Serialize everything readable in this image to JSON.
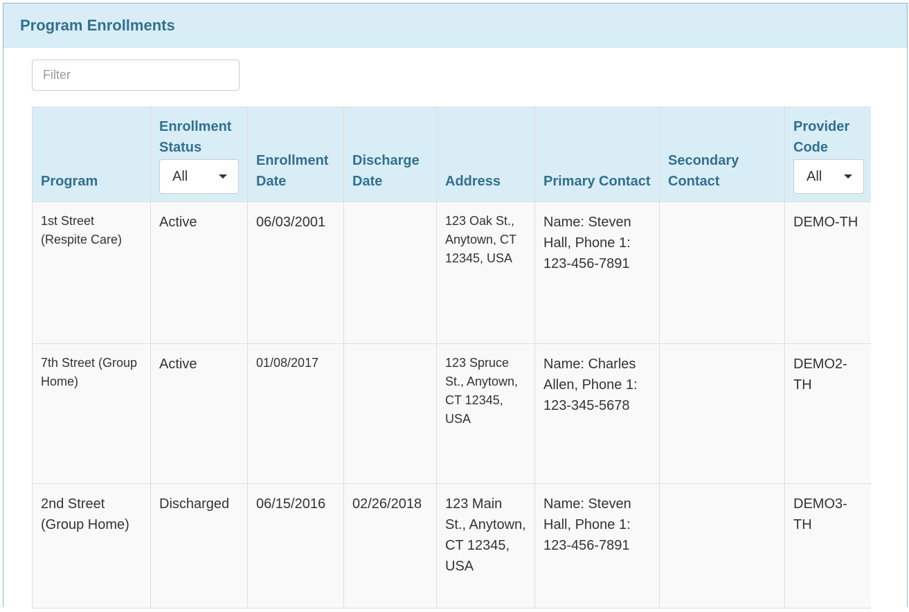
{
  "panel": {
    "title": "Program Enrollments"
  },
  "filter": {
    "placeholder": "Filter"
  },
  "table": {
    "headers": {
      "program": "Program",
      "enrollment_status": "Enrollment Status",
      "enrollment_date": "Enrollment Date",
      "discharge_date": "Discharge Date",
      "address": "Address",
      "primary_contact": "Primary Contact",
      "secondary_contact": "Secondary Contact",
      "provider_code": "Provider Code"
    },
    "status_filter": {
      "selected": "All"
    },
    "provider_filter": {
      "selected": "All"
    },
    "rows": [
      {
        "program": "1st Street (Respite Care)",
        "status": "Active",
        "enrollment_date": "06/03/2001",
        "discharge_date": "",
        "address": "123 Oak St., Anytown, CT 12345, USA",
        "primary_contact": "Name: Steven Hall, Phone 1: 123-456-7891",
        "secondary_contact": "",
        "provider_code": "DEMO-TH"
      },
      {
        "program": "7th Street (Group Home)",
        "status": "Active",
        "enrollment_date": "01/08/2017",
        "discharge_date": "",
        "address": "123 Spruce St., Anytown, CT 12345, USA",
        "primary_contact": "Name: Charles Allen, Phone 1: 123-345-5678",
        "secondary_contact": "",
        "provider_code": "DEMO2-TH"
      },
      {
        "program": "2nd Street (Group Home)",
        "status": "Discharged",
        "enrollment_date": "06/15/2016",
        "discharge_date": "02/26/2018",
        "address": "123 Main St., Anytown, CT 12345, USA",
        "primary_contact": "Name: Steven Hall, Phone 1: 123-456-7891",
        "secondary_contact": "",
        "provider_code": "DEMO3-TH"
      }
    ]
  }
}
